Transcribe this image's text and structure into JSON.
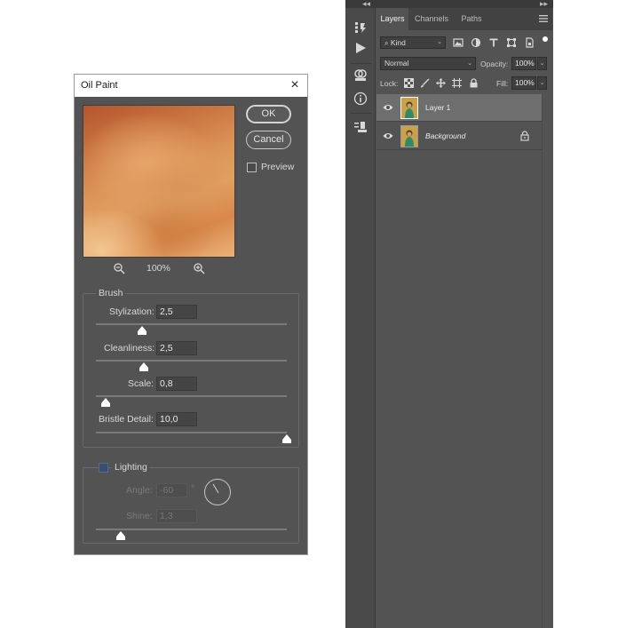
{
  "dialog": {
    "title": "Oil Paint",
    "close_glyph": "×",
    "ok_label": "OK",
    "cancel_label": "Cancel",
    "preview_label": "Preview",
    "zoom_level": "100%",
    "brush": {
      "group_label": "Brush",
      "stylization": {
        "label": "Stylization:",
        "value": "2,5",
        "slider_fraction": 0.24
      },
      "cleanliness": {
        "label": "Cleanliness:",
        "value": "2,5",
        "slider_fraction": 0.25
      },
      "scale": {
        "label": "Scale:",
        "value": "0,8",
        "slider_fraction": 0.05
      },
      "bristle_detail": {
        "label": "Bristle Detail:",
        "value": "10,0",
        "slider_fraction": 1.0
      }
    },
    "lighting": {
      "group_label": "Lighting",
      "checked": false,
      "angle": {
        "label": "Angle:",
        "value": "-60",
        "unit": "°"
      },
      "shine": {
        "label": "Shine:",
        "value": "1,3",
        "slider_fraction": 0.13
      }
    }
  },
  "layers_panel": {
    "tabs": [
      "Layers",
      "Channels",
      "Paths"
    ],
    "active_tab": "Layers",
    "filter_kind": "Kind",
    "blend_mode": "Normal",
    "opacity_label": "Opacity:",
    "opacity_value": "100%",
    "lock_label": "Lock:",
    "fill_label": "Fill:",
    "fill_value": "100%",
    "layers": [
      {
        "name": "Layer 1",
        "selected": true,
        "locked": false
      },
      {
        "name": "Background",
        "selected": false,
        "locked": true
      }
    ]
  },
  "toolstrip": {
    "icons": [
      "history-icon",
      "actions-play-icon",
      "color-settings-icon",
      "info-icon",
      "properties-icon"
    ]
  },
  "colors": {
    "panel_bg": "#535353",
    "selected_layer": "#6e6e6e",
    "lighting_checkbox": "#3a4e70"
  }
}
